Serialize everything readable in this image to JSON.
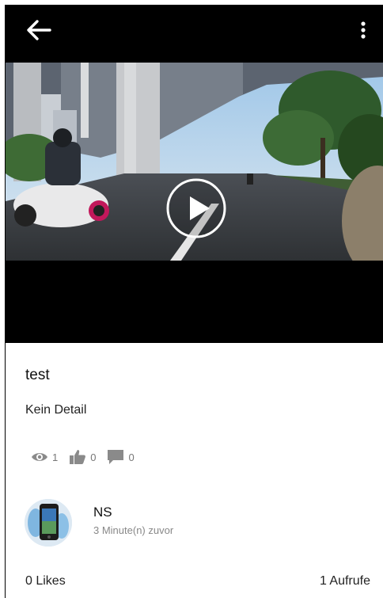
{
  "video": {
    "title": "test",
    "detail": "Kein Detail"
  },
  "stats": {
    "views": "1",
    "likes": "0",
    "comments": "0"
  },
  "author": {
    "name": "NS",
    "time": "3 Minute(n) zuvor"
  },
  "footer": {
    "likes_label": "0 Likes",
    "views_label": "1 Aufrufe"
  },
  "icons": {
    "back": "arrow-left-icon",
    "menu": "more-vertical-icon",
    "play": "play-circle-icon",
    "views": "eye-icon",
    "likes": "thumb-up-icon",
    "comments": "comment-icon"
  },
  "colors": {
    "topbar": "#000000",
    "stat_icon": "#8a8a8a",
    "muted_text": "#888888"
  }
}
